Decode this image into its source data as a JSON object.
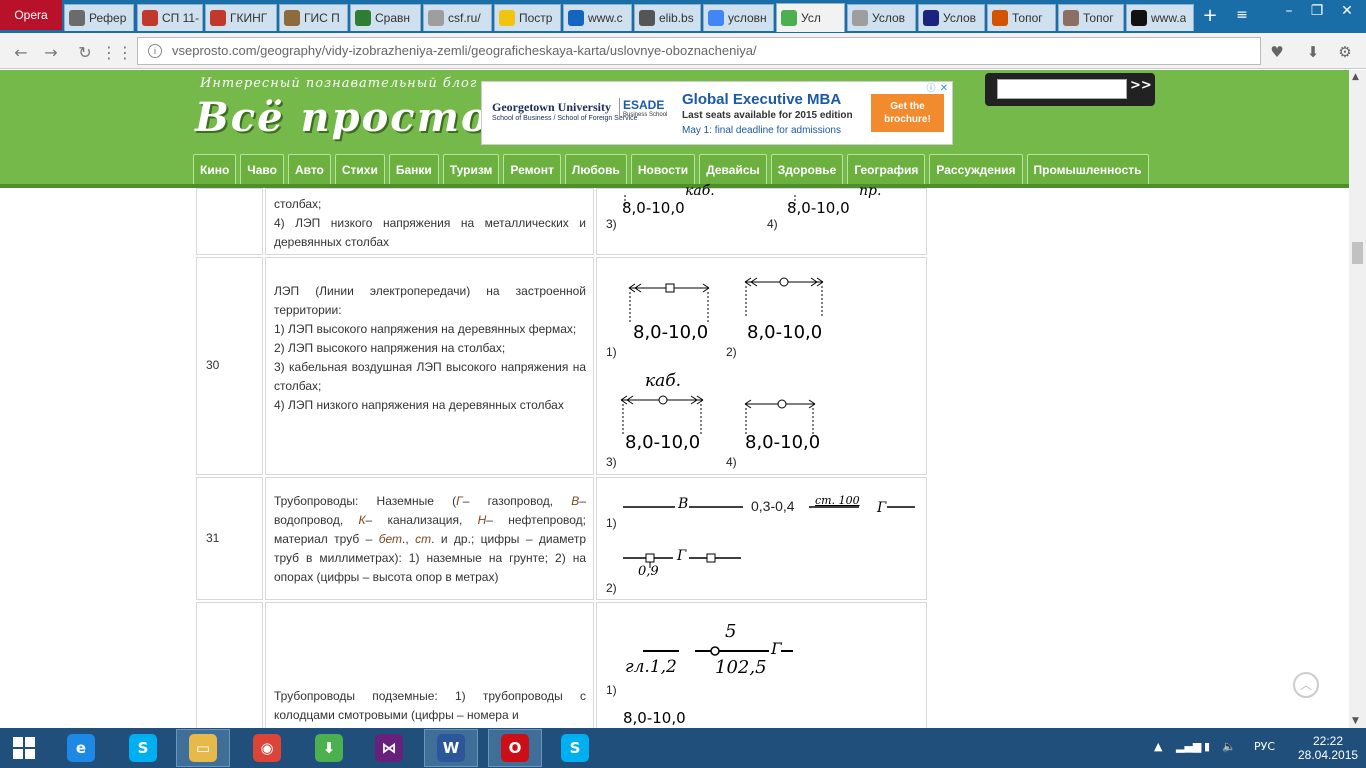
{
  "browser": {
    "opera_label": "Opera",
    "tabs": [
      {
        "title": "Рефер",
        "color": "#6b6b6b"
      },
      {
        "title": "СП 11-",
        "color": "#c0392b"
      },
      {
        "title": "ГКИНГ",
        "color": "#c0392b"
      },
      {
        "title": "ГИС П",
        "color": "#8e6b3d"
      },
      {
        "title": "Сравн",
        "color": "#2e7d32"
      },
      {
        "title": "csf.ru/",
        "color": "#9e9e9e"
      },
      {
        "title": "Постр",
        "color": "#f1c40f"
      },
      {
        "title": "www.c",
        "color": "#1565c0"
      },
      {
        "title": "elib.bs",
        "color": "#555555"
      },
      {
        "title": "условн",
        "color": "#4285f4"
      },
      {
        "title": "Усл",
        "color": "#4caf50"
      },
      {
        "title": "Услов",
        "color": "#9e9e9e"
      },
      {
        "title": "Услов",
        "color": "#1a237e"
      },
      {
        "title": "Топог",
        "color": "#d35400"
      },
      {
        "title": "Топог",
        "color": "#8d6e63"
      },
      {
        "title": "www.a",
        "color": "#111111"
      }
    ],
    "active_tab_index": 10,
    "url": "vseprosto.com/geography/vidy-izobrazheniya-zemli/geograficheskaya-karta/uslovnye-oboznacheniya/"
  },
  "site": {
    "tagline": "Интересный познавательный блог",
    "logo": "Всё просто",
    "search_go": ">>",
    "menu": [
      "Кино",
      "Чаво",
      "Авто",
      "Стихи",
      "Банки",
      "Туризм",
      "Ремонт",
      "Любовь",
      "Новости",
      "Девайсы",
      "Здоровье",
      "География",
      "Рассуждения",
      "Промышленность"
    ]
  },
  "ad": {
    "university": "Georgetown University",
    "university_sub": "School of Business / School of Foreign Service",
    "esade": "ESADE",
    "esade_sub": "Business School",
    "headline": "Global Executive MBA",
    "line1": "Last seats available for 2015 edition",
    "line2": "May 1: final deadline for admissions",
    "cta": "Get the brochure!"
  },
  "table": {
    "top_row": {
      "text_line1": "столбах;",
      "text_line2": "4) ЛЭП низкого напряжения на металлических и деревянных столбах",
      "sym3_label": "3)",
      "sym4_label": "4)",
      "sym_value": "8,0-10,0",
      "sym_kab": "каб.",
      "sym_pr": "пр."
    },
    "row30": {
      "num": "30",
      "lines": [
        "ЛЭП (Линии электропередачи) на застроенной территории:",
        "1) ЛЭП высокого напряжения на деревянных фермах;",
        "2) ЛЭП высокого напряжения на столбах;",
        "3) кабельная воздушная ЛЭП высокого напряжения на столбах;",
        "4) ЛЭП низкого напряжения на деревянных столбах"
      ],
      "labels": [
        "1)",
        "2)",
        "3)",
        "4)"
      ],
      "value": "8,0-10,0",
      "kab": "каб."
    },
    "row31": {
      "num": "31",
      "desc_parts": [
        "Трубопроводы: Наземные (",
        "Г",
        "– газопровод, ",
        "В",
        "– водопровод, ",
        "К",
        "– канализация, ",
        "Н",
        "– нефтепровод; материал труб – ",
        "бет",
        "., ",
        "ст",
        ". и др.; цифры – диаметр труб в миллиметрах): 1) наземные на грунте; 2) на опорах (цифры – высота опор в метрах)"
      ],
      "label1": "1)",
      "label2": "2)",
      "sym_B": "В",
      "sym_dim": "0,3-0,4",
      "sym_st": "ст. 100",
      "sym_G": "Г",
      "sym_h": "0,9"
    },
    "row32": {
      "lines": [
        "Трубопроводы подземные: 1) трубопроводы с колодцами смотровыми (цифры – номера и"
      ],
      "label1": "1)",
      "gl": "гл.1,2",
      "five": "5",
      "frac": "102,5",
      "G": "Г",
      "value": "8,0-10,0"
    }
  },
  "taskbar": {
    "lang": "РУС",
    "time": "22:22",
    "date": "28.04.2015",
    "apps": [
      {
        "name": "internet-explorer",
        "color": "#1e88e5",
        "glyph": "e"
      },
      {
        "name": "skype",
        "color": "#00aff0",
        "glyph": "S"
      },
      {
        "name": "file-explorer",
        "color": "#e6b94a",
        "glyph": "▭"
      },
      {
        "name": "chrome",
        "color": "#db4437",
        "glyph": "◉"
      },
      {
        "name": "download-manager",
        "color": "#4caf50",
        "glyph": "⬇"
      },
      {
        "name": "visual-studio",
        "color": "#68217a",
        "glyph": "⋈"
      },
      {
        "name": "word",
        "color": "#2b579a",
        "glyph": "W"
      },
      {
        "name": "opera",
        "color": "#cc0f16",
        "glyph": "O"
      },
      {
        "name": "skype-2",
        "color": "#00aff0",
        "glyph": "S"
      }
    ]
  }
}
